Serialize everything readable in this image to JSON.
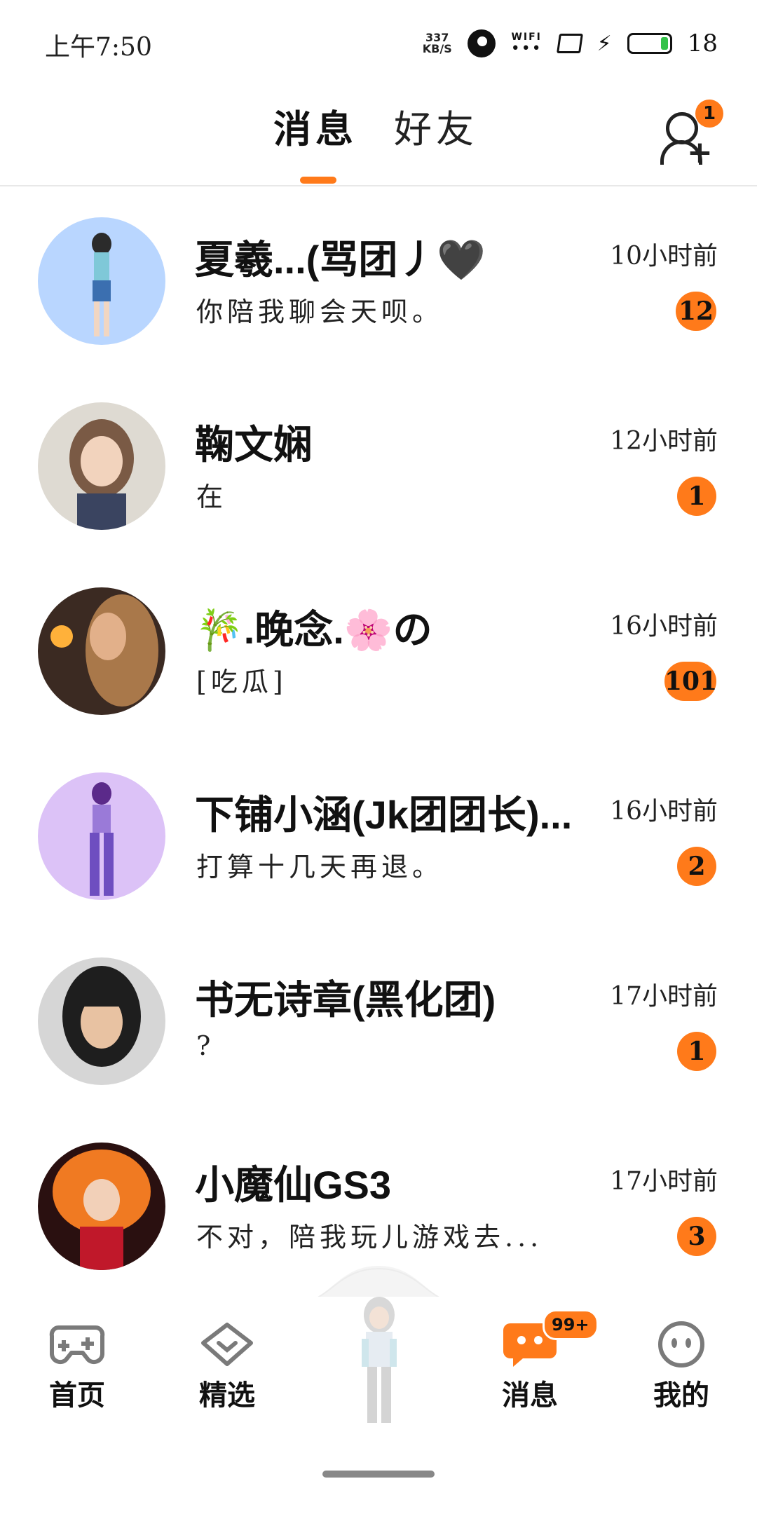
{
  "status_bar": {
    "time": "上午7:50",
    "speed_value": "337",
    "speed_unit": "KB/S",
    "wifi_label": "WIFI",
    "battery": "18"
  },
  "header": {
    "tabs": [
      {
        "label": "消息",
        "active": true
      },
      {
        "label": "好友",
        "active": false
      }
    ],
    "add_friend_badge": "1"
  },
  "conversations": [
    {
      "name": "夏羲...(骂团丿🖤",
      "time": "10小时前",
      "message": "你陪我聊会天呗。",
      "unread": "12",
      "avatar_color": "#b9d6ff"
    },
    {
      "name": "鞠文娴",
      "time": "12小时前",
      "message": "在",
      "unread": "1",
      "avatar_color": "#dedad2"
    },
    {
      "name": "🎋.晚念.🌸の",
      "time": "16小时前",
      "message": "[吃瓜]",
      "unread": "101",
      "avatar_color": "#3b2a22"
    },
    {
      "name": "下铺小涵(Jk团团长)...",
      "time": "16小时前",
      "message": "打算十几天再退。",
      "unread": "2",
      "avatar_color": "#dcc2f7"
    },
    {
      "name": "书无诗章(黑化团)",
      "time": "17小时前",
      "message": "?",
      "unread": "1",
      "avatar_color": "#d6d6d6"
    },
    {
      "name": "小魔仙GS3",
      "time": "17小时前",
      "message": "不对，陪我玩儿游戏去...",
      "unread": "3",
      "avatar_color": "#2a1010"
    }
  ],
  "bottom_nav": {
    "items": [
      {
        "label": "首页",
        "icon": "gamepad-icon"
      },
      {
        "label": "精选",
        "icon": "heart-chevron-icon"
      },
      {
        "label": "消息",
        "icon": "chat-bubble-icon",
        "badge": "99+"
      },
      {
        "label": "我的",
        "icon": "face-icon"
      }
    ]
  },
  "colors": {
    "accent": "#ff7a1a",
    "text": "#111111",
    "divider": "#e8e8e8"
  }
}
